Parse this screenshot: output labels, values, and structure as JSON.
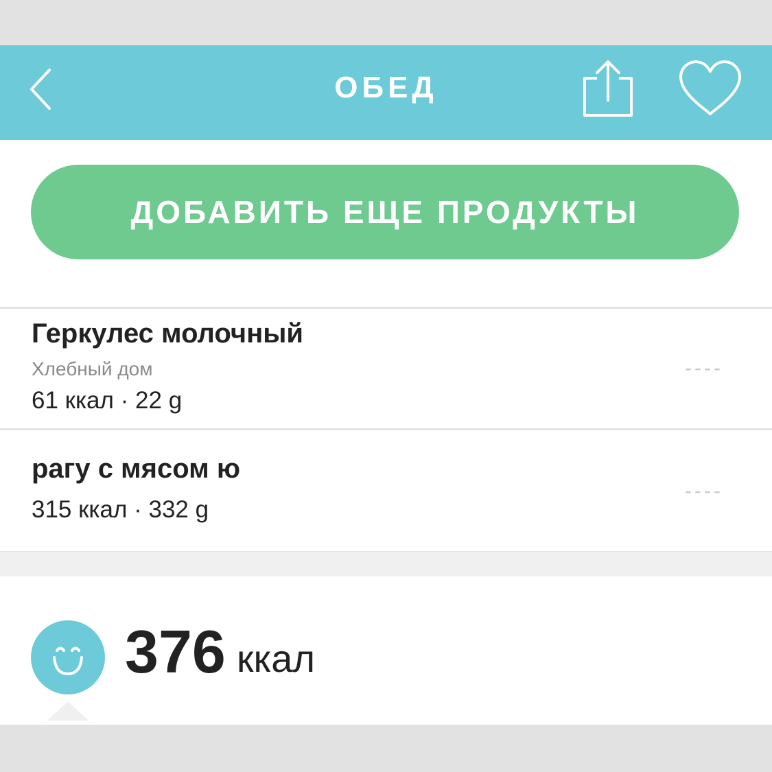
{
  "header": {
    "title": "ОБЕД",
    "back_icon": "chevron-left-icon",
    "share_icon": "share-icon",
    "favorite_icon": "heart-outline-icon",
    "background_color": "#6ccad9"
  },
  "add_button": {
    "label": "ДОБАВИТЬ ЕЩЕ ПРОДУКТЫ",
    "color": "#6fca90"
  },
  "items": [
    {
      "name": "Геркулес молочный",
      "brand": "Хлебный дом",
      "meta": "61 ккал · 22 g",
      "dash": "----"
    },
    {
      "name": "рагу с мясом ю",
      "meta": "315 ккал · 332 g",
      "dash": "----"
    }
  ],
  "summary": {
    "icon": "smiley-icon",
    "value": "376",
    "unit": "ккал"
  }
}
